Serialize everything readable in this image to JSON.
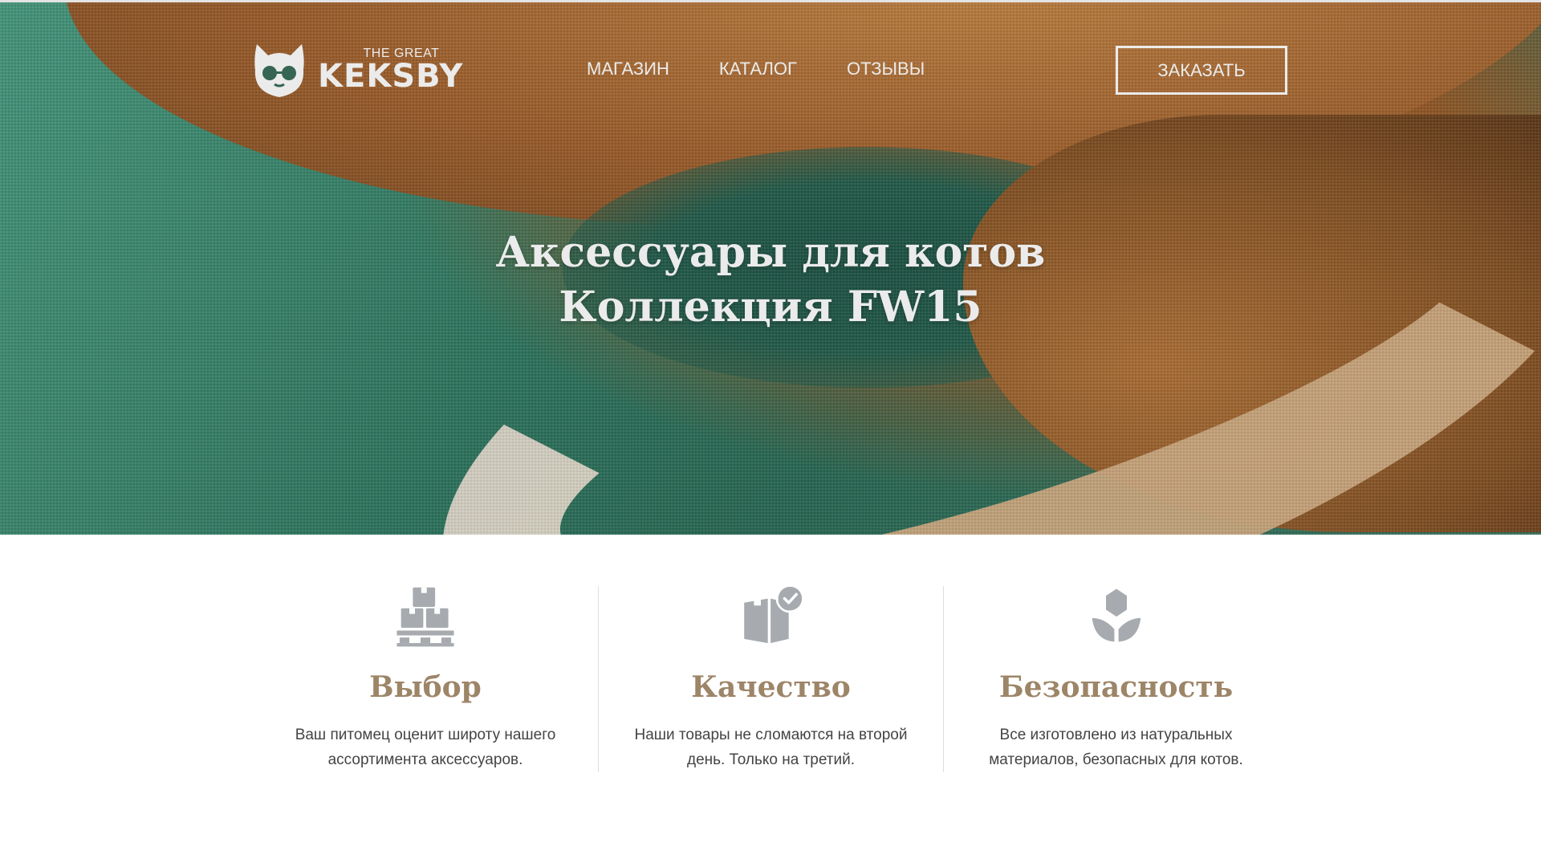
{
  "brand": {
    "small": "THE GREAT",
    "big": "KEKSBY",
    "logo_icon": "cat-with-glasses-icon"
  },
  "nav": {
    "items": [
      {
        "label": "МАГАЗИН"
      },
      {
        "label": "КАТАЛОГ"
      },
      {
        "label": "ОТЗЫВЫ"
      }
    ],
    "order_label": "ЗАКАЗАТЬ"
  },
  "hero": {
    "title_line1": "Аксессуары для котов",
    "title_line2": "Коллекция FW15"
  },
  "features": [
    {
      "icon": "boxes-pallet-icon",
      "title": "Выбор",
      "text": "Ваш питомец оценит широту нашего ассортимента аксессуаров."
    },
    {
      "icon": "box-check-icon",
      "title": "Качество",
      "text": "Наши товары не сломаются на второй день. Только на третий."
    },
    {
      "icon": "leaf-sprout-icon",
      "title": "Безопасность",
      "text": "Все изготовлено из натуральных материалов, безопасных для котов."
    }
  ],
  "colors": {
    "accent_heading": "#9d8568",
    "icon_gray": "#a7abb0",
    "body_text": "#444444"
  }
}
